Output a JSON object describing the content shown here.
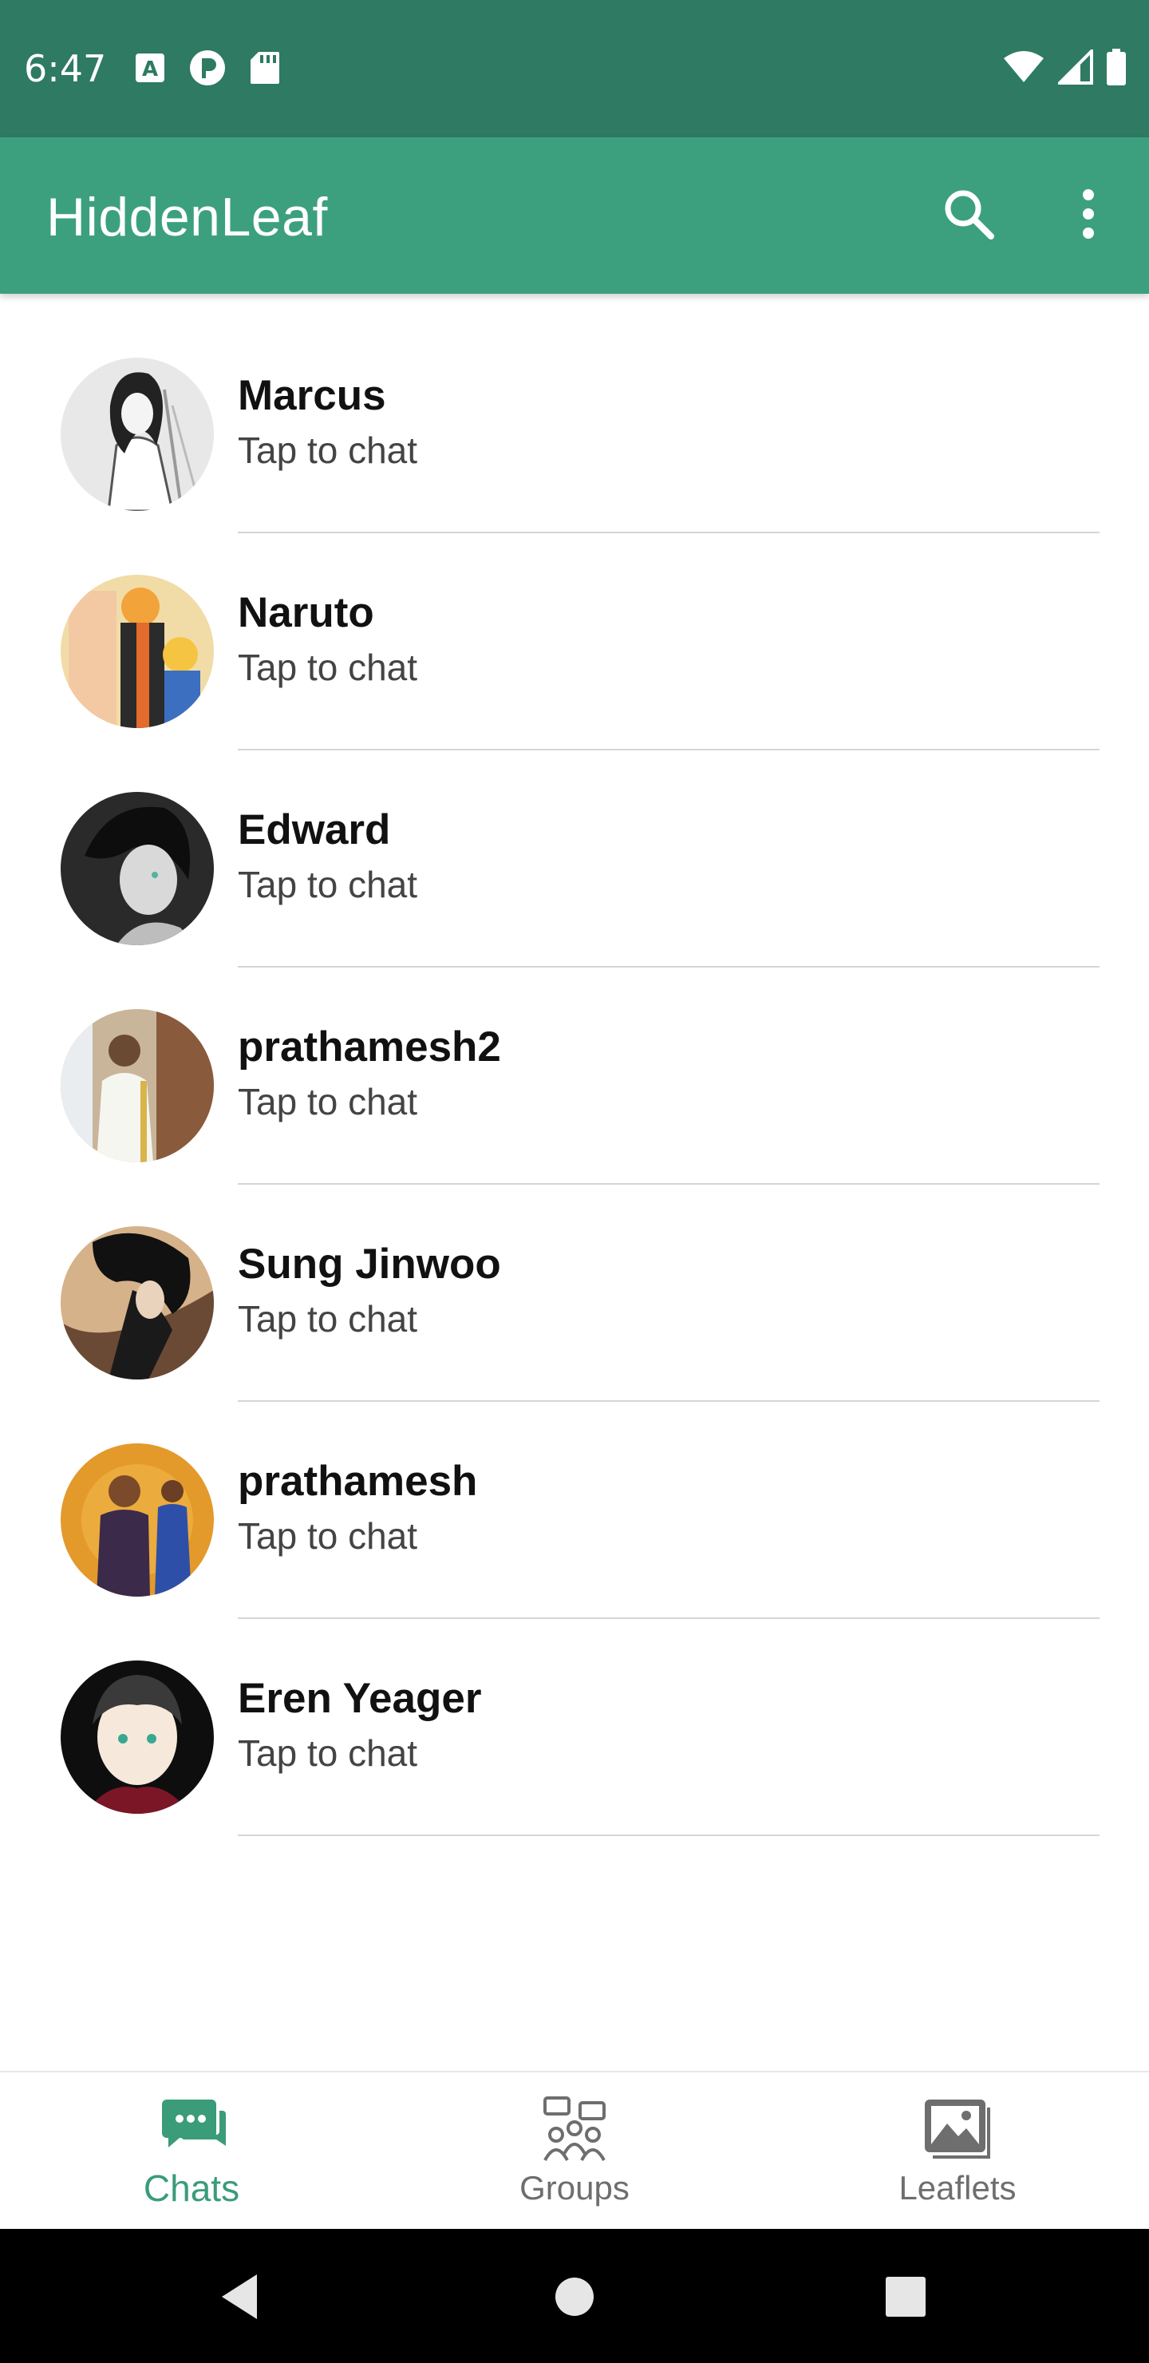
{
  "status_bar": {
    "time": "6:47",
    "left_icons": [
      "a-icon",
      "p-icon",
      "sd-card-icon"
    ],
    "right_icons": [
      "wifi-icon",
      "signal-icon",
      "battery-icon"
    ]
  },
  "app_bar": {
    "title": "HiddenLeaf",
    "actions": [
      "search-icon",
      "more-vert-icon"
    ]
  },
  "chats": [
    {
      "name": "Marcus",
      "subtitle": "Tap to chat"
    },
    {
      "name": "Naruto",
      "subtitle": "Tap to chat"
    },
    {
      "name": "Edward",
      "subtitle": "Tap to chat"
    },
    {
      "name": "prathamesh2",
      "subtitle": "Tap to chat"
    },
    {
      "name": "Sung Jinwoo",
      "subtitle": "Tap to chat"
    },
    {
      "name": "prathamesh",
      "subtitle": "Tap to chat"
    },
    {
      "name": "Eren Yeager",
      "subtitle": "Tap to chat"
    }
  ],
  "bottom_nav": {
    "items": [
      {
        "label": "Chats",
        "icon": "chats-icon",
        "active": true
      },
      {
        "label": "Groups",
        "icon": "groups-icon",
        "active": false
      },
      {
        "label": "Leaflets",
        "icon": "leaflets-icon",
        "active": false
      }
    ]
  },
  "colors": {
    "status_bar": "#2e7a62",
    "app_bar": "#3ca07e",
    "accent": "#3a9c79",
    "inactive": "#6e6e6e"
  }
}
